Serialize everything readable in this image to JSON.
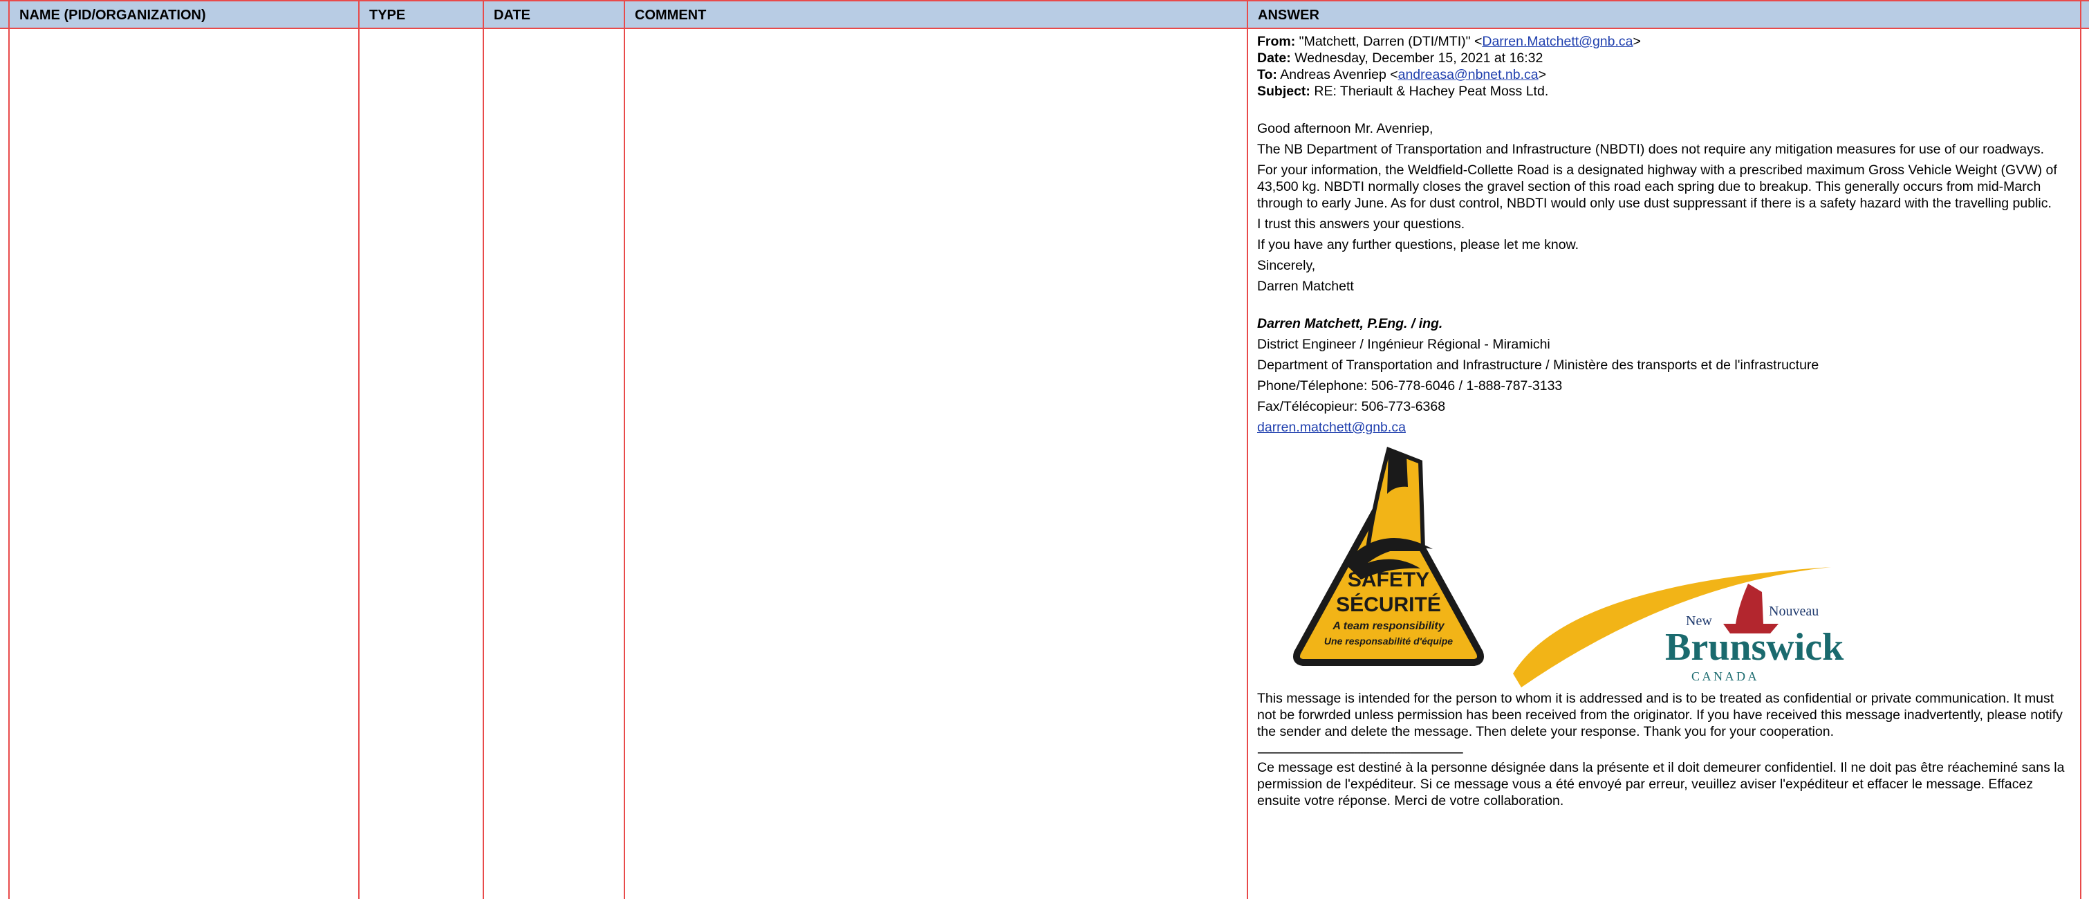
{
  "columns": [
    {
      "label": "NAME (PID/ORGANIZATION)"
    },
    {
      "label": "TYPE"
    },
    {
      "label": "DATE"
    },
    {
      "label": "COMMENT"
    },
    {
      "label": "ANSWER"
    }
  ],
  "email": {
    "from_label": "From:",
    "from_value": "\"Matchett, Darren (DTI/MTI)\" <",
    "from_email": "Darren.Matchett@gnb.ca",
    "from_close": ">",
    "date_label": "Date:",
    "date_value": "Wednesday, December 15, 2021 at 16:32",
    "to_label": "To:",
    "to_value": "Andreas Avenriep <",
    "to_email": "andreasa@nbnet.nb.ca",
    "to_close": ">",
    "subject_label": "Subject:",
    "subject_value": "RE: Theriault & Hachey Peat Moss Ltd."
  },
  "body": {
    "greeting": "Good afternoon Mr. Avenriep,",
    "p1": "The NB Department of Transportation and Infrastructure (NBDTI) does not require any mitigation measures for use of our roadways.",
    "p2": "For your information, the Weldfield-Collette Road is a designated highway with a prescribed maximum Gross Vehicle Weight (GVW) of 43,500 kg.  NBDTI normally closes the gravel section of this road each spring due to breakup.  This generally occurs from mid-March through to early June.   As for dust control, NBDTI would only use dust suppressant if there is a safety hazard with the travelling public.",
    "p3": "I trust this answers your questions.",
    "p4": "If you have any further questions, please let me know.",
    "closing": "Sincerely,",
    "name": "Darren Matchett"
  },
  "signature": {
    "name": "Darren Matchett, P.Eng. / ing.",
    "title": "District Engineer / Ingénieur Régional - Miramichi",
    "department": "Department of Transportation and Infrastructure / Ministère des transports et de l'infrastructure",
    "phone": "Phone/Télephone:  506-778-6046 / 1-888-787-3133",
    "fax": "Fax/Télécopieur:  506-773-6368",
    "email": "darren.matchett@gnb.ca"
  },
  "logos": {
    "safety_line1": "SAFETY",
    "safety_line2": "SÉCURITÉ",
    "safety_line3": "A team responsibility",
    "safety_line4": "Une responsabilité d'équipe",
    "nb_new": "New",
    "nb_nouveau": "Nouveau",
    "nb_name": "Brunswick",
    "nb_canada": "C A N A D A",
    "colors": {
      "yellow": "#f2b417",
      "navy": "#1f3a6e",
      "teal": "#1a6a6e",
      "red": "#b3262e"
    }
  },
  "disclaimer": {
    "en": "This message is intended for the person to whom it is addressed and is to be treated as confidential or private communication.  It must not be forwrded unless permission has been received from the originator.  If you have received this message inadvertently, please notify the sender and delete the message. Then delete your response. Thank you for your cooperation.",
    "separator": "------------------------------------------------------------------",
    "fr": "Ce message est destiné à la personne désignée dans la présente et il doit demeurer confidentiel.  Il ne doit pas être réacheminé sans la permission de l'expéditeur.  Si ce message vous a été envoyé par erreur, veuillez aviser l'expéditeur et effacer le message.  Effacez ensuite votre réponse.  Merci de votre collaboration."
  }
}
